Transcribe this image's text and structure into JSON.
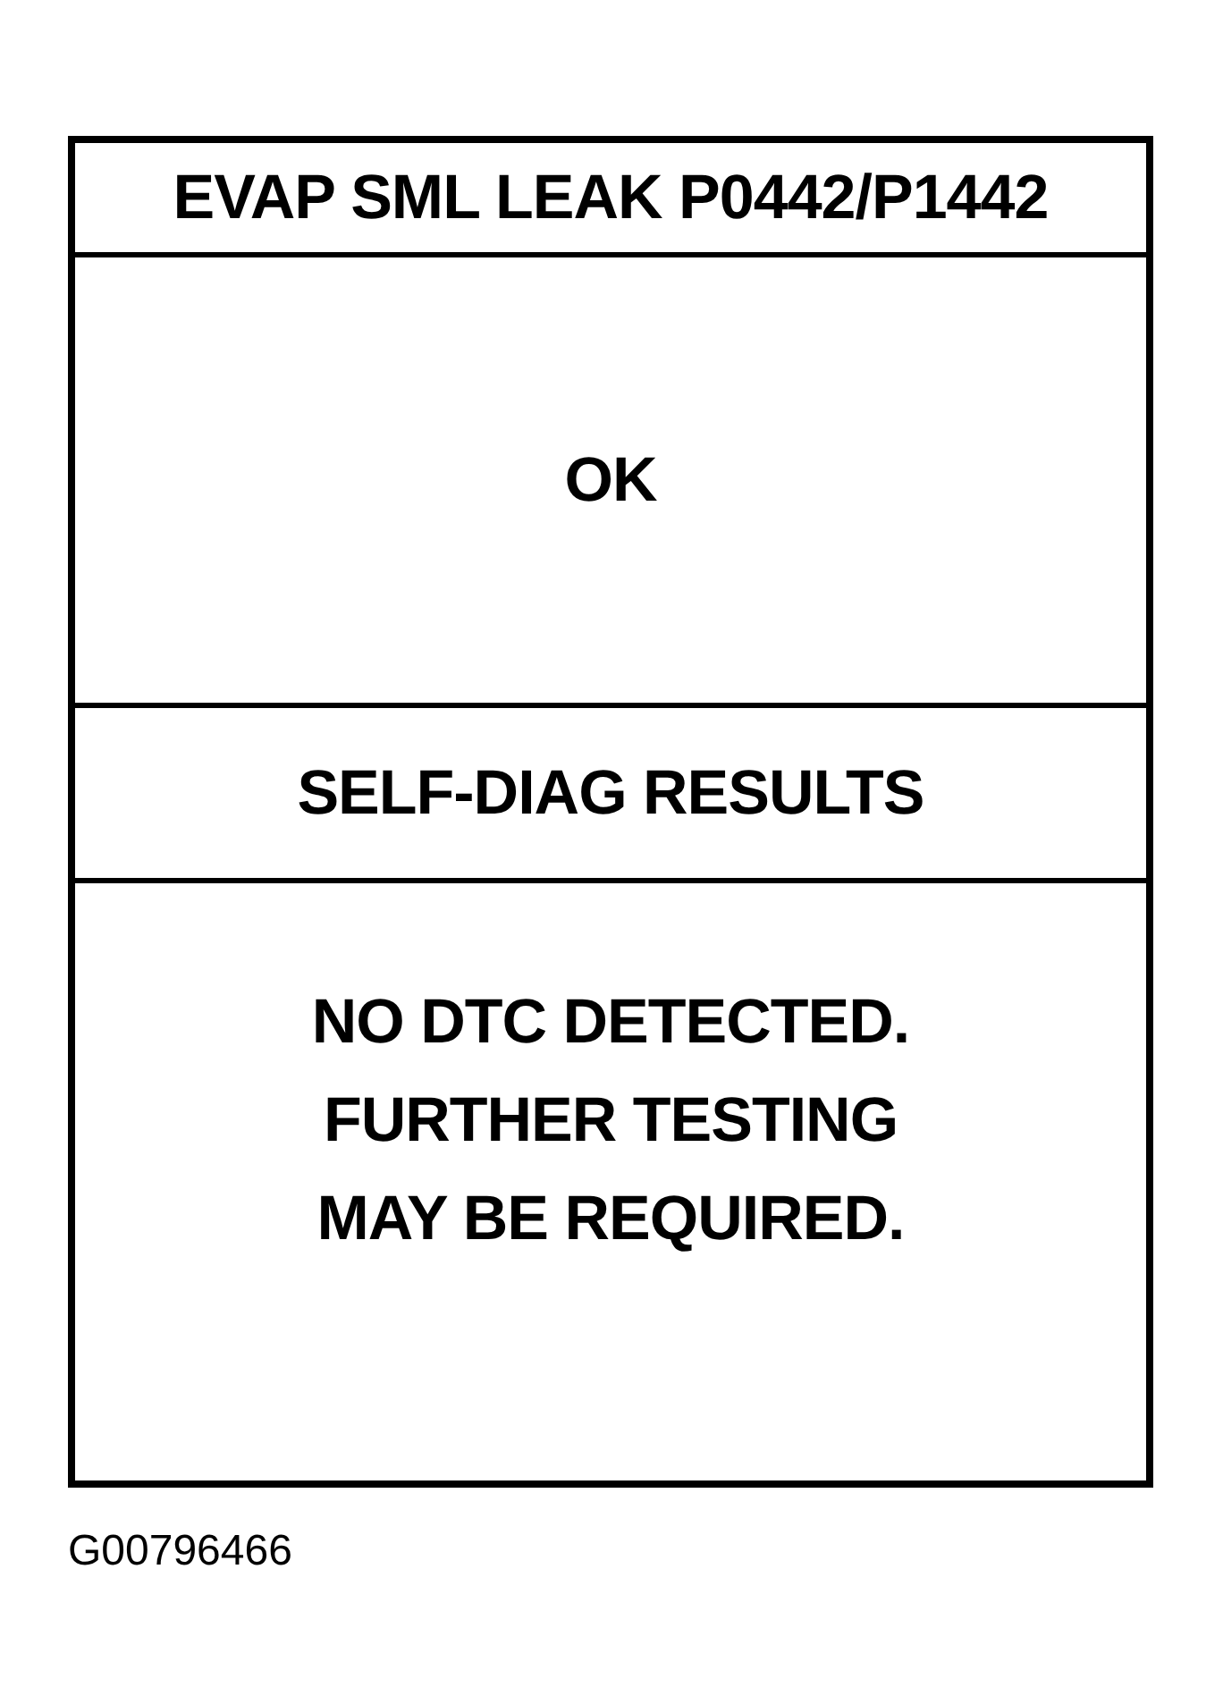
{
  "title": "EVAP SML LEAK P0442/P1442",
  "status": "OK",
  "section_heading": "SELF-DIAG RESULTS",
  "message": [
    "NO DTC DETECTED.",
    "FURTHER TESTING",
    "MAY BE REQUIRED."
  ],
  "figure_id": "G00796466"
}
